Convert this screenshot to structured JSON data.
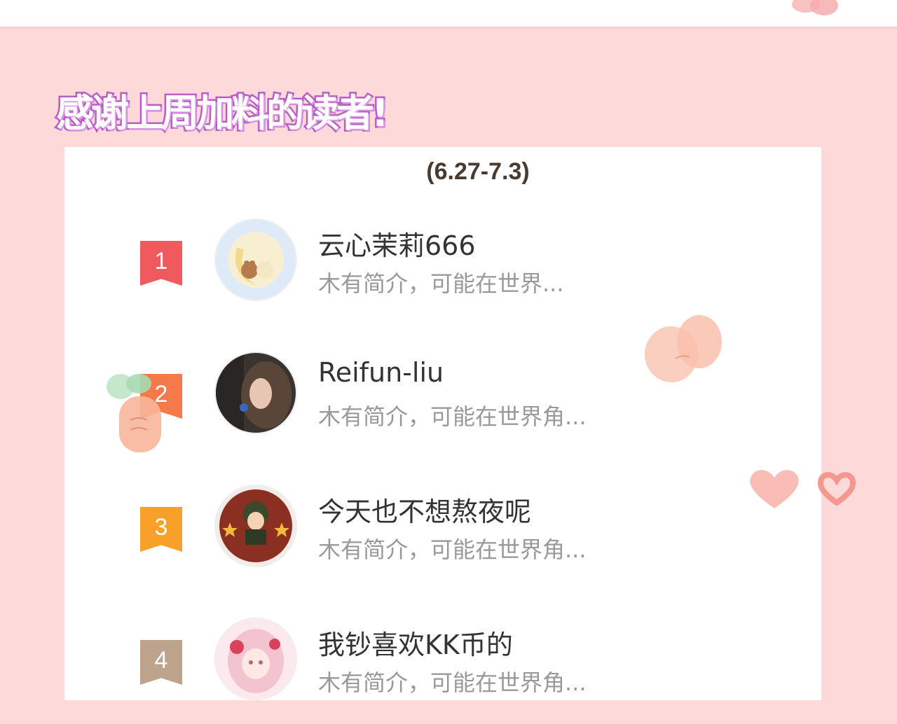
{
  "heading": "感谢上周加料的读者!",
  "date_range": "(6.27-7.3)",
  "readers": [
    {
      "rank": "1",
      "name": "云心茉莉666",
      "bio": "木有简介，可能在世界...",
      "rank_color": "#f0595d"
    },
    {
      "rank": "2",
      "name": "Reifun-liu",
      "bio": "木有简介，可能在世界角...",
      "rank_color": "#f6794a"
    },
    {
      "rank": "3",
      "name": "今天也不想熬夜呢",
      "bio": "木有简介，可能在世界角...",
      "rank_color": "#f9a02a"
    },
    {
      "rank": "4",
      "name": "我钞喜欢KK币的",
      "bio": "木有简介，可能在世界角...",
      "rank_color": "#bda38c"
    }
  ],
  "colors": {
    "background": "#fdd9da",
    "heading_stroke": "#bb5bc6",
    "card": "#ffffff"
  }
}
